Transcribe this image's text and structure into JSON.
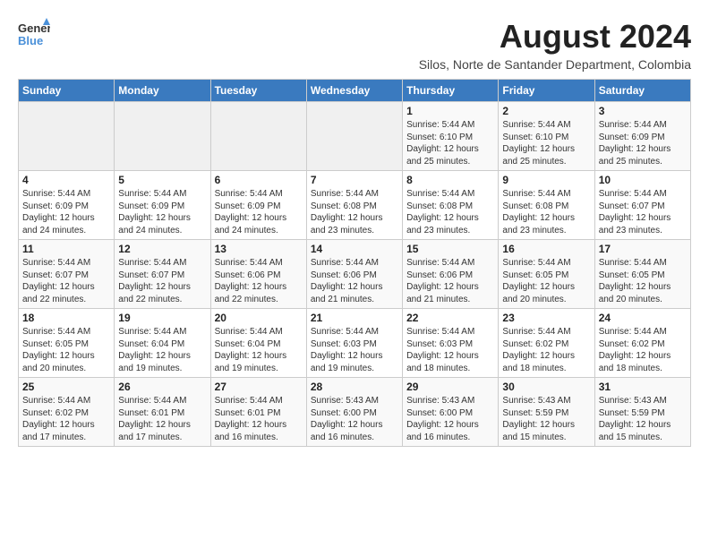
{
  "header": {
    "logo_general": "General",
    "logo_blue": "Blue",
    "month_title": "August 2024",
    "location": "Silos, Norte de Santander Department, Colombia"
  },
  "weekdays": [
    "Sunday",
    "Monday",
    "Tuesday",
    "Wednesday",
    "Thursday",
    "Friday",
    "Saturday"
  ],
  "weeks": [
    [
      {
        "day": "",
        "info": ""
      },
      {
        "day": "",
        "info": ""
      },
      {
        "day": "",
        "info": ""
      },
      {
        "day": "",
        "info": ""
      },
      {
        "day": "1",
        "info": "Sunrise: 5:44 AM\nSunset: 6:10 PM\nDaylight: 12 hours\nand 25 minutes."
      },
      {
        "day": "2",
        "info": "Sunrise: 5:44 AM\nSunset: 6:10 PM\nDaylight: 12 hours\nand 25 minutes."
      },
      {
        "day": "3",
        "info": "Sunrise: 5:44 AM\nSunset: 6:09 PM\nDaylight: 12 hours\nand 25 minutes."
      }
    ],
    [
      {
        "day": "4",
        "info": "Sunrise: 5:44 AM\nSunset: 6:09 PM\nDaylight: 12 hours\nand 24 minutes."
      },
      {
        "day": "5",
        "info": "Sunrise: 5:44 AM\nSunset: 6:09 PM\nDaylight: 12 hours\nand 24 minutes."
      },
      {
        "day": "6",
        "info": "Sunrise: 5:44 AM\nSunset: 6:09 PM\nDaylight: 12 hours\nand 24 minutes."
      },
      {
        "day": "7",
        "info": "Sunrise: 5:44 AM\nSunset: 6:08 PM\nDaylight: 12 hours\nand 23 minutes."
      },
      {
        "day": "8",
        "info": "Sunrise: 5:44 AM\nSunset: 6:08 PM\nDaylight: 12 hours\nand 23 minutes."
      },
      {
        "day": "9",
        "info": "Sunrise: 5:44 AM\nSunset: 6:08 PM\nDaylight: 12 hours\nand 23 minutes."
      },
      {
        "day": "10",
        "info": "Sunrise: 5:44 AM\nSunset: 6:07 PM\nDaylight: 12 hours\nand 23 minutes."
      }
    ],
    [
      {
        "day": "11",
        "info": "Sunrise: 5:44 AM\nSunset: 6:07 PM\nDaylight: 12 hours\nand 22 minutes."
      },
      {
        "day": "12",
        "info": "Sunrise: 5:44 AM\nSunset: 6:07 PM\nDaylight: 12 hours\nand 22 minutes."
      },
      {
        "day": "13",
        "info": "Sunrise: 5:44 AM\nSunset: 6:06 PM\nDaylight: 12 hours\nand 22 minutes."
      },
      {
        "day": "14",
        "info": "Sunrise: 5:44 AM\nSunset: 6:06 PM\nDaylight: 12 hours\nand 21 minutes."
      },
      {
        "day": "15",
        "info": "Sunrise: 5:44 AM\nSunset: 6:06 PM\nDaylight: 12 hours\nand 21 minutes."
      },
      {
        "day": "16",
        "info": "Sunrise: 5:44 AM\nSunset: 6:05 PM\nDaylight: 12 hours\nand 20 minutes."
      },
      {
        "day": "17",
        "info": "Sunrise: 5:44 AM\nSunset: 6:05 PM\nDaylight: 12 hours\nand 20 minutes."
      }
    ],
    [
      {
        "day": "18",
        "info": "Sunrise: 5:44 AM\nSunset: 6:05 PM\nDaylight: 12 hours\nand 20 minutes."
      },
      {
        "day": "19",
        "info": "Sunrise: 5:44 AM\nSunset: 6:04 PM\nDaylight: 12 hours\nand 19 minutes."
      },
      {
        "day": "20",
        "info": "Sunrise: 5:44 AM\nSunset: 6:04 PM\nDaylight: 12 hours\nand 19 minutes."
      },
      {
        "day": "21",
        "info": "Sunrise: 5:44 AM\nSunset: 6:03 PM\nDaylight: 12 hours\nand 19 minutes."
      },
      {
        "day": "22",
        "info": "Sunrise: 5:44 AM\nSunset: 6:03 PM\nDaylight: 12 hours\nand 18 minutes."
      },
      {
        "day": "23",
        "info": "Sunrise: 5:44 AM\nSunset: 6:02 PM\nDaylight: 12 hours\nand 18 minutes."
      },
      {
        "day": "24",
        "info": "Sunrise: 5:44 AM\nSunset: 6:02 PM\nDaylight: 12 hours\nand 18 minutes."
      }
    ],
    [
      {
        "day": "25",
        "info": "Sunrise: 5:44 AM\nSunset: 6:02 PM\nDaylight: 12 hours\nand 17 minutes."
      },
      {
        "day": "26",
        "info": "Sunrise: 5:44 AM\nSunset: 6:01 PM\nDaylight: 12 hours\nand 17 minutes."
      },
      {
        "day": "27",
        "info": "Sunrise: 5:44 AM\nSunset: 6:01 PM\nDaylight: 12 hours\nand 16 minutes."
      },
      {
        "day": "28",
        "info": "Sunrise: 5:43 AM\nSunset: 6:00 PM\nDaylight: 12 hours\nand 16 minutes."
      },
      {
        "day": "29",
        "info": "Sunrise: 5:43 AM\nSunset: 6:00 PM\nDaylight: 12 hours\nand 16 minutes."
      },
      {
        "day": "30",
        "info": "Sunrise: 5:43 AM\nSunset: 5:59 PM\nDaylight: 12 hours\nand 15 minutes."
      },
      {
        "day": "31",
        "info": "Sunrise: 5:43 AM\nSunset: 5:59 PM\nDaylight: 12 hours\nand 15 minutes."
      }
    ]
  ]
}
